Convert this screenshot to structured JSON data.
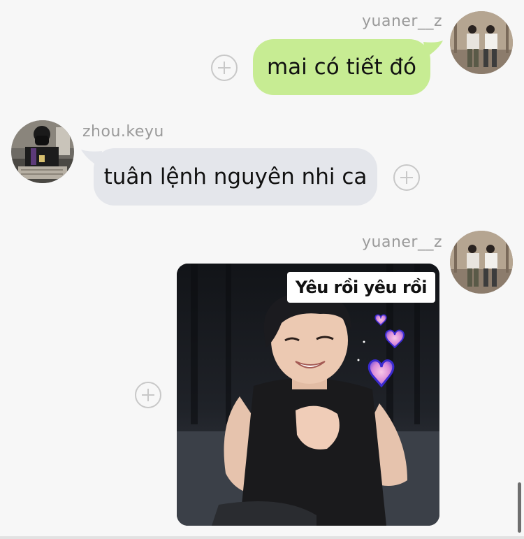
{
  "messages": [
    {
      "sender": "yuaner__z",
      "side": "right",
      "type": "text",
      "text": "mai có tiết đó"
    },
    {
      "sender": "zhou.keyu",
      "side": "left",
      "type": "text",
      "text": "tuân lệnh nguyên nhi ca"
    },
    {
      "sender": "yuaner__z",
      "side": "right",
      "type": "sticker",
      "caption": "Yêu rồi yêu rồi"
    }
  ],
  "colors": {
    "background": "#f7f7f7",
    "my_bubble": "#c7ec93",
    "other_bubble": "#e4e6eb",
    "username": "#9a9a9a"
  },
  "icons": {
    "add": "plus-circle-icon"
  }
}
